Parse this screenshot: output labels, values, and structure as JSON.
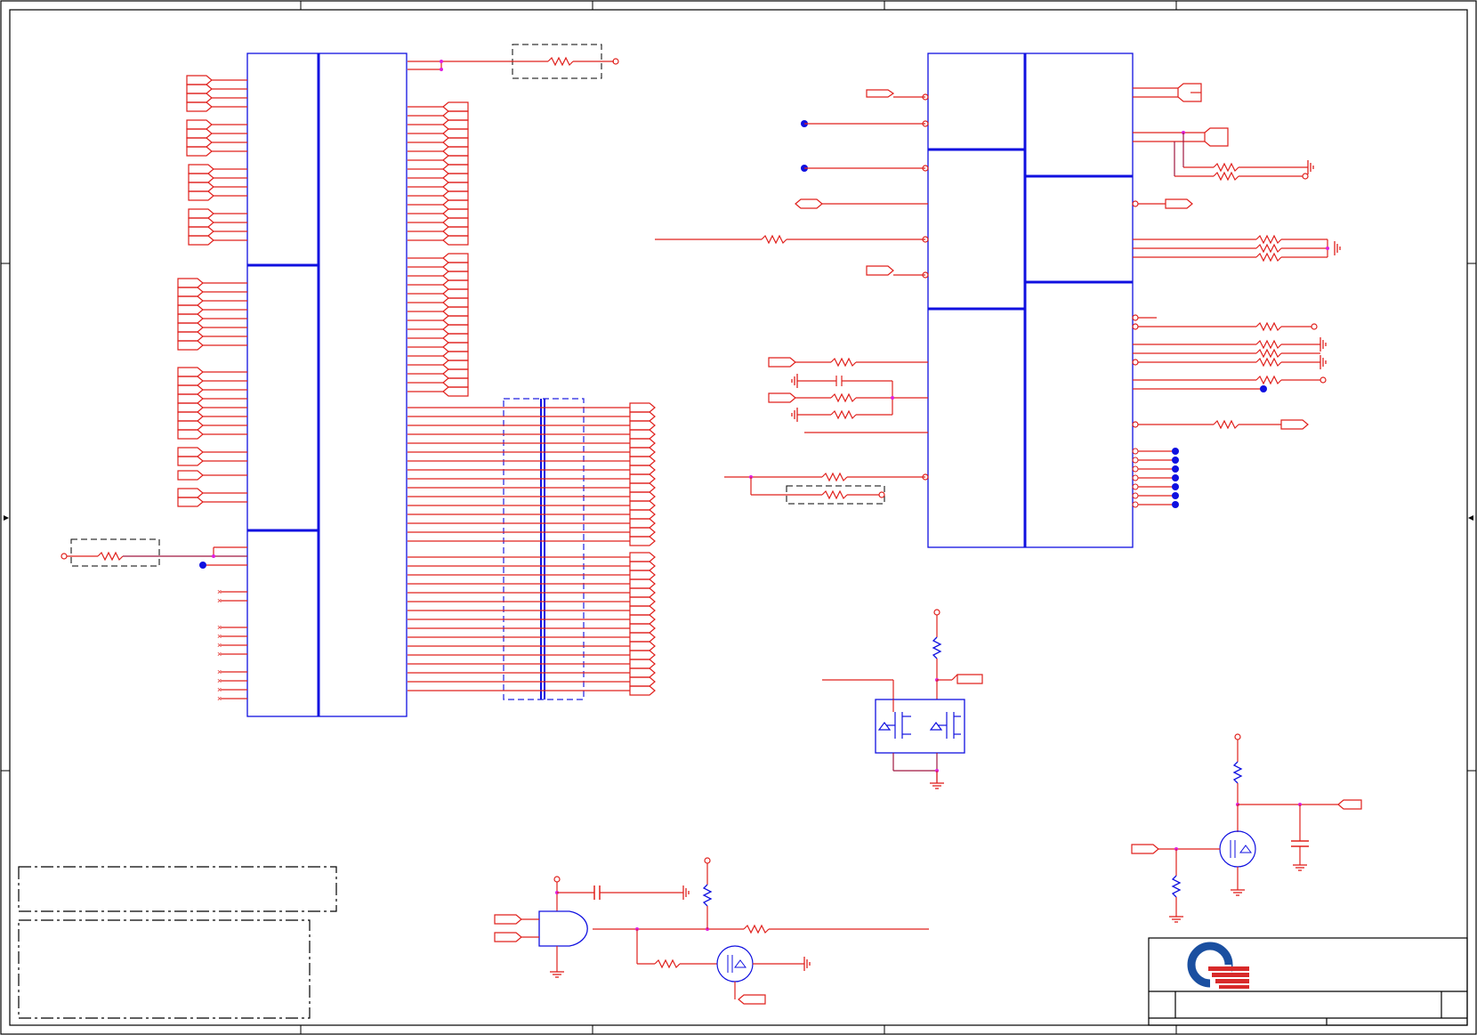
{
  "colors": {
    "wire": "#e0201c",
    "wire_dark": "#a01840",
    "component": "#1010e0",
    "junction": "#e020e0",
    "logo_blue": "#1a4fa0",
    "logo_red": "#d82a2a"
  },
  "icons": [
    "company-logo",
    "ground-symbol",
    "mosfet-symbol",
    "and-gate-symbol",
    "resistor-symbol",
    "capacitor-symbol"
  ]
}
